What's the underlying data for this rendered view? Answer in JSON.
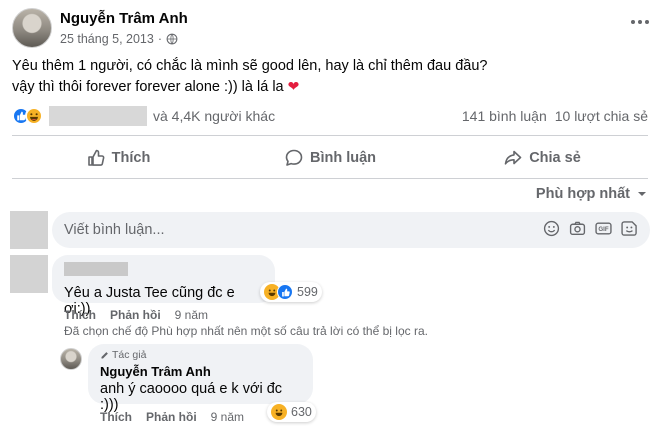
{
  "post": {
    "author": "Nguyễn Trâm Anh",
    "date": "25 tháng 5, 2013",
    "text_line1": "Yêu thêm 1 người, có chắc là mình sẽ good lên, hay là chỉ thêm đau đầu?",
    "text_line2": "vậy thì thôi forever forever alone :)) là lá la",
    "icons": {
      "privacy": "globe-icon",
      "more": "more-dots-icon",
      "heart": "❤"
    },
    "colors": {
      "heart": "#e41e3f",
      "like": "#1877f2",
      "haha": "#f7b125"
    }
  },
  "reactions": {
    "others_text": "và 4,4K người khác",
    "comments_count": "141 bình luận",
    "shares_count": "10 lượt chia sẻ"
  },
  "actions": {
    "like": "Thích",
    "comment": "Bình luận",
    "share": "Chia sẻ"
  },
  "sort": {
    "label": "Phù hợp nhất"
  },
  "composer": {
    "placeholder": "Viết bình luận...",
    "tools": [
      "smile-icon",
      "camera-icon",
      "gif-icon",
      "sticker-icon"
    ],
    "gif_label": "GIF"
  },
  "comments": [
    {
      "text": "Yêu a Justa Tee cũng đc e ơi:))",
      "reaction_count": "599",
      "like_label": "Thích",
      "reply_label": "Phản hồi",
      "time": "9 năm",
      "filter_note": "Đã chọn chế độ Phù hợp nhất nên một số câu trả lời có thể bị lọc ra."
    }
  ],
  "replies": [
    {
      "badge": "Tác giả",
      "author": "Nguyễn Trâm Anh",
      "text": "anh ý caoooo quá e k với đc :)))",
      "reaction_count": "630",
      "like_label": "Thích",
      "reply_label": "Phản hồi",
      "time": "9 năm"
    }
  ]
}
